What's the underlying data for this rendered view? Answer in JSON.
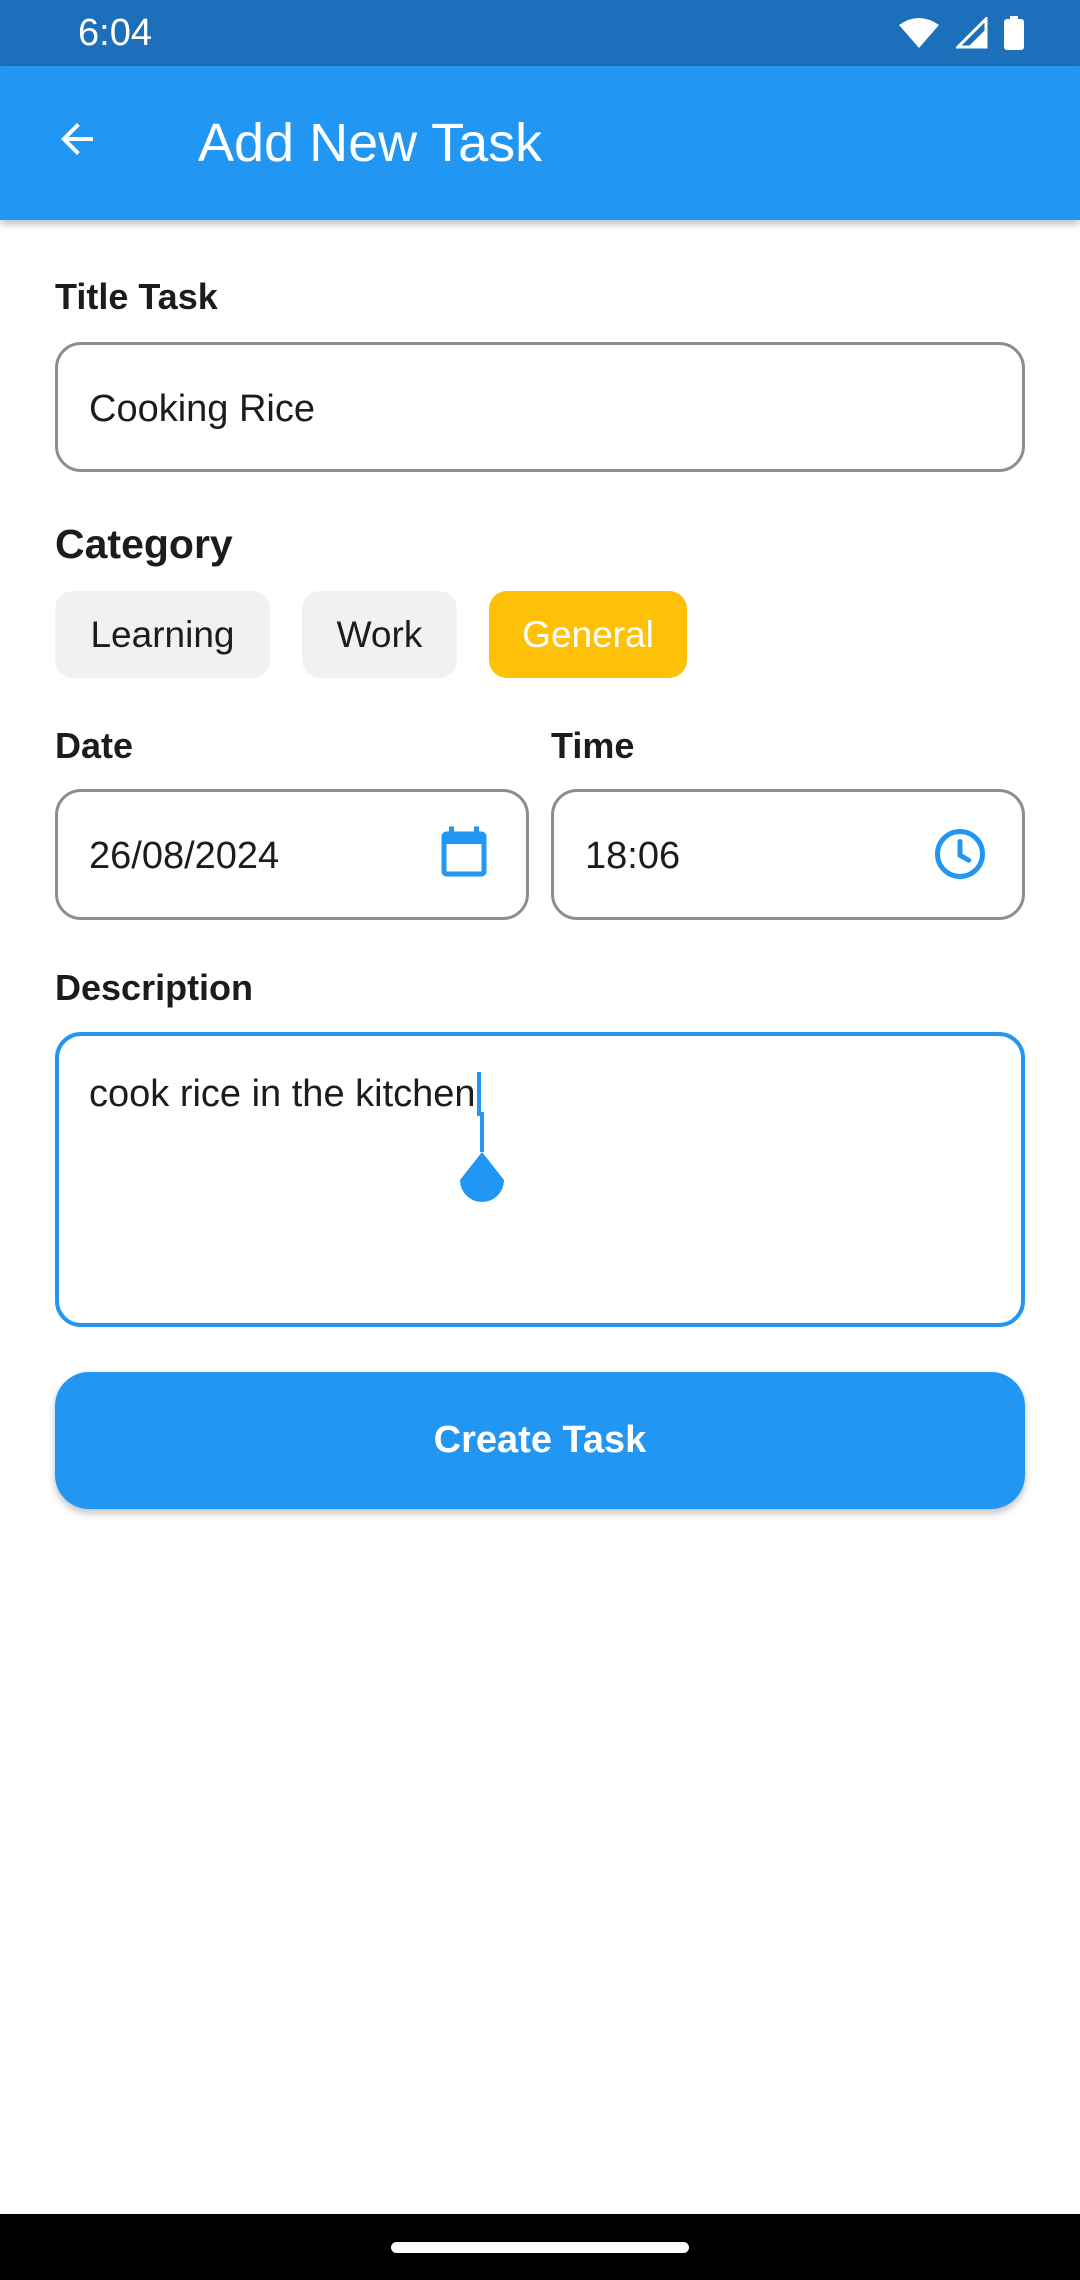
{
  "status_bar": {
    "time": "6:04",
    "icons": [
      "wifi-icon",
      "signal-icon",
      "battery-icon"
    ]
  },
  "app_bar": {
    "title": "Add New Task",
    "back_icon": "arrow-back-icon"
  },
  "form": {
    "title_label": "Title Task",
    "title_value": "Cooking Rice",
    "category_label": "Category",
    "categories": [
      {
        "label": "Learning",
        "selected": false
      },
      {
        "label": "Work",
        "selected": false
      },
      {
        "label": "General",
        "selected": true
      }
    ],
    "date_label": "Date",
    "date_value": "26/08/2024",
    "date_icon": "calendar-icon",
    "time_label": "Time",
    "time_value": "18:06",
    "time_icon": "clock-icon",
    "description_label": "Description",
    "description_value": "cook rice in the kitchen",
    "submit_label": "Create Task"
  },
  "colors": {
    "primary": "#2196f3",
    "status_bar": "#1c6fba",
    "chip_selected": "#ffc107",
    "chip_unselected": "#f1f1f1"
  }
}
